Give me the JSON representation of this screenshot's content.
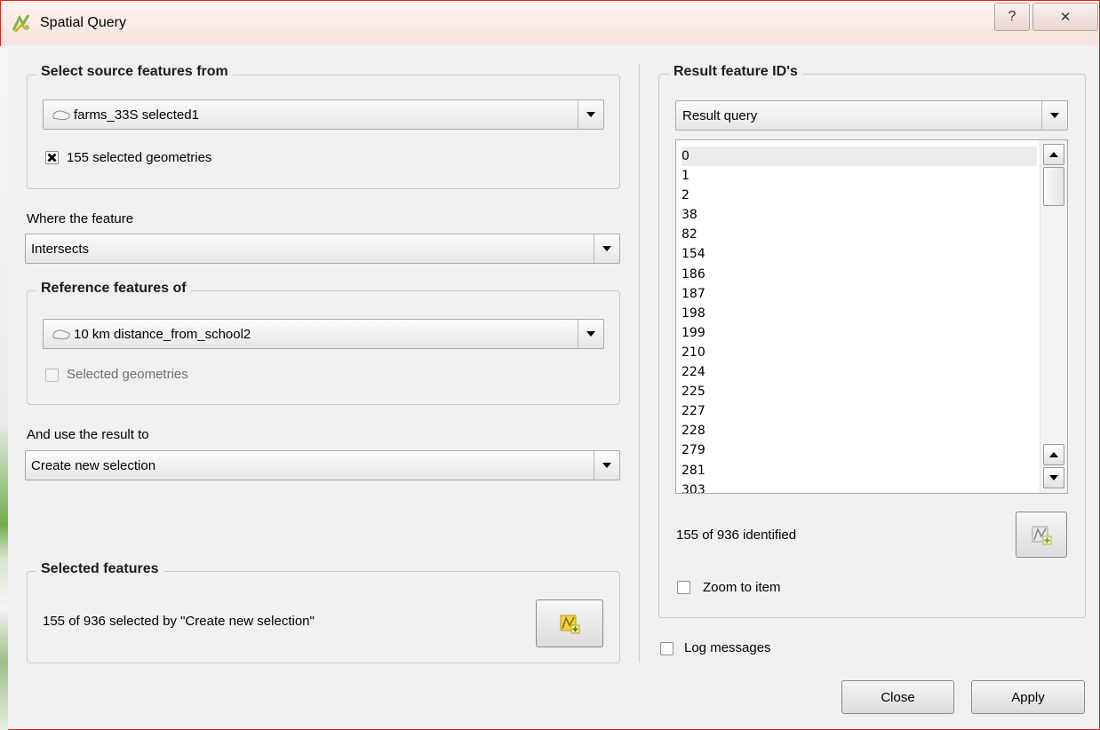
{
  "window": {
    "title": "Spatial Query",
    "help_glyph": "?",
    "close_glyph": "✕"
  },
  "source": {
    "legend": "Select source features from",
    "layer": "farms_33S selected1",
    "checkbox_label": "155 selected geometries",
    "checkbox_checked": true
  },
  "where": {
    "label": "Where the feature",
    "value": "Intersects"
  },
  "reference": {
    "legend": "Reference features of",
    "layer": "10 km distance_from_school2",
    "checkbox_label": "Selected geometries",
    "checkbox_checked": false
  },
  "use_result": {
    "label": "And use the result to",
    "value": "Create new selection"
  },
  "selected_features": {
    "legend": "Selected features",
    "text": "155 of 936 selected by \"Create new selection\""
  },
  "result": {
    "legend": "Result feature ID's",
    "combo_value": "Result query",
    "ids": [
      "0",
      "1",
      "2",
      "38",
      "82",
      "154",
      "186",
      "187",
      "198",
      "199",
      "210",
      "224",
      "225",
      "227",
      "228",
      "279",
      "281",
      "303"
    ],
    "identified": "155 of 936 identified",
    "zoom_label": "Zoom to item"
  },
  "log_messages_label": "Log messages",
  "buttons": {
    "close": "Close",
    "apply": "Apply"
  },
  "icons": {
    "app": "spatial-query-icon",
    "layer": "polygon-layer-icon",
    "select": "select-features-icon"
  },
  "colors": {
    "window_border": "#e02020",
    "titlebar": "#f7e3dc",
    "icon_yellow": "#f5d33c"
  }
}
